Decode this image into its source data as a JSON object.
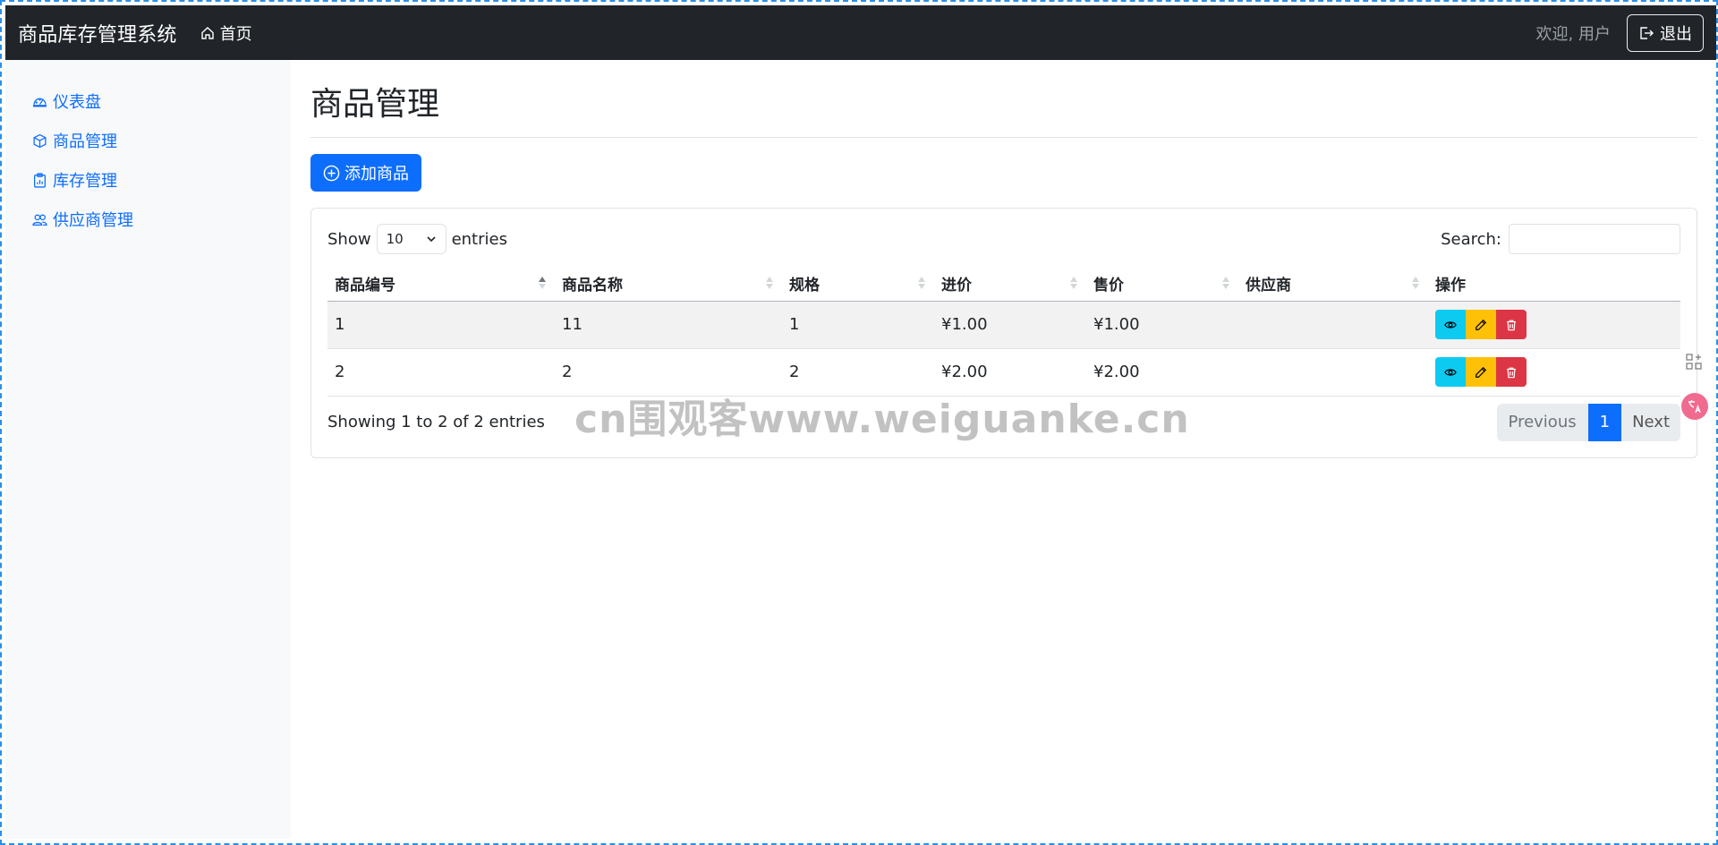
{
  "navbar": {
    "brand": "商品库存管理系统",
    "home_label": "首页",
    "welcome": "欢迎, 用户",
    "logout_label": "退出"
  },
  "sidebar": {
    "items": [
      {
        "label": "仪表盘",
        "icon": "speedometer-icon"
      },
      {
        "label": "商品管理",
        "icon": "box-icon"
      },
      {
        "label": "库存管理",
        "icon": "clipboard-chart-icon"
      },
      {
        "label": "供应商管理",
        "icon": "people-icon"
      }
    ]
  },
  "main": {
    "title": "商品管理",
    "add_button_label": "添加商品",
    "table_controls": {
      "show_label": "Show",
      "page_length": "10",
      "entries_label": "entries",
      "search_label": "Search:",
      "search_value": ""
    },
    "columns": [
      "商品编号",
      "商品名称",
      "规格",
      "进价",
      "售价",
      "供应商",
      "操作"
    ],
    "rows": [
      {
        "id": "1",
        "name": "11",
        "spec": "1",
        "cost": "¥1.00",
        "price": "¥1.00",
        "supplier": ""
      },
      {
        "id": "2",
        "name": "2",
        "spec": "2",
        "cost": "¥2.00",
        "price": "¥2.00",
        "supplier": ""
      }
    ],
    "info": "Showing 1 to 2 of 2 entries",
    "pagination": {
      "previous": "Previous",
      "current": "1",
      "next": "Next"
    }
  },
  "watermark": "cn围观客www.weiguanke.cn",
  "colors": {
    "navbar_bg": "#212529",
    "primary": "#0d6efd",
    "info": "#0dcaf0",
    "warning": "#ffc107",
    "danger": "#dc3545",
    "sidebar_bg": "#f8f9fa"
  }
}
